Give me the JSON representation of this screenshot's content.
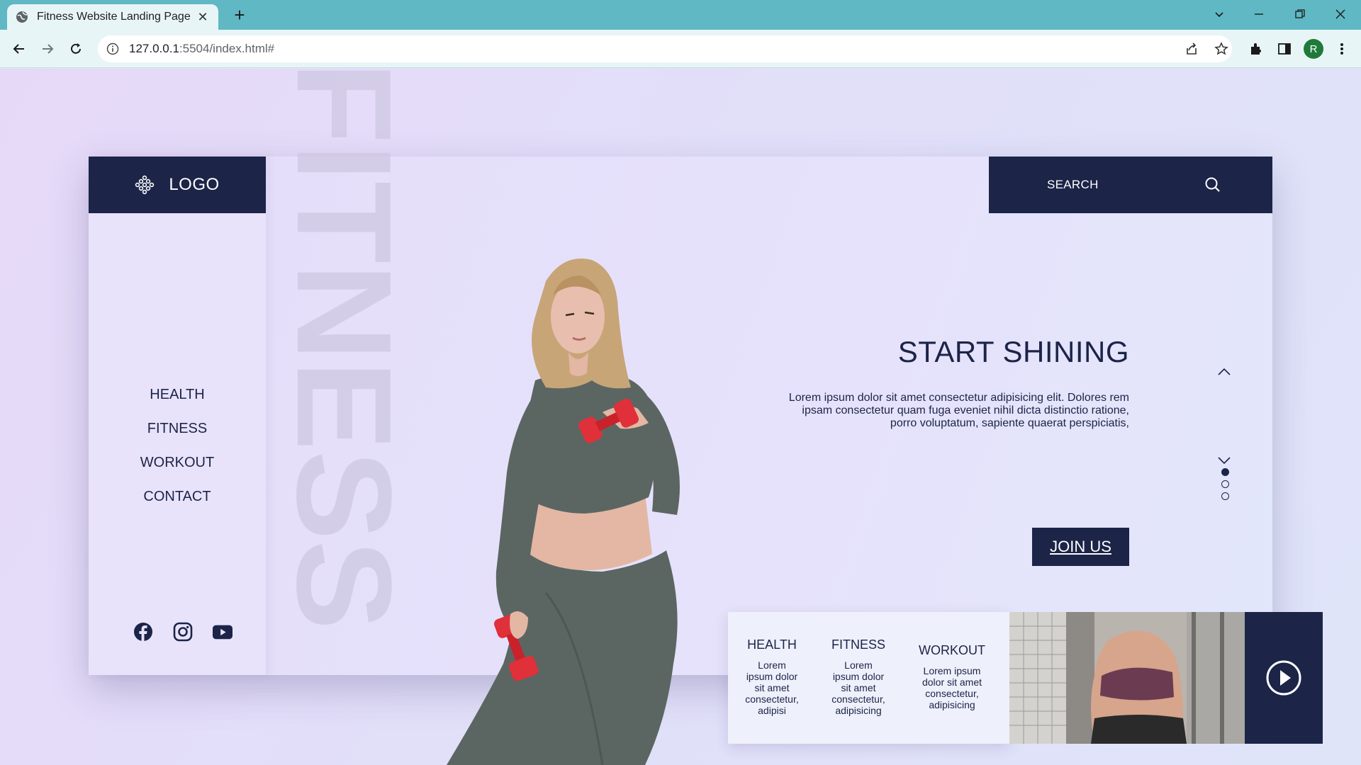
{
  "browser": {
    "tab_title": "Fitness Website Landing Page",
    "url_host": "127.0.0.1",
    "url_path": ":5504/index.html#",
    "profile_initial": "R"
  },
  "page": {
    "background_word": "FITNESS",
    "logo": {
      "text": "LOGO"
    },
    "nav": [
      {
        "label": "HEALTH"
      },
      {
        "label": "FITNESS"
      },
      {
        "label": "WORKOUT"
      },
      {
        "label": "CONTACT"
      }
    ],
    "socials": [
      "facebook-icon",
      "instagram-icon",
      "youtube-icon"
    ],
    "search": {
      "label": "SEARCH"
    },
    "hero": {
      "title": "START SHINING",
      "text_line1": "Lorem ipsum dolor sit amet consectetur adipisicing elit. Dolores rem",
      "text_line2": "ipsam consectetur quam fuga eveniet nihil dicta distinctio ratione,",
      "text_line3": "porro voluptatum, sapiente quaerat perspiciatis,",
      "cta": "JOIN US"
    },
    "slider": {
      "total": 3,
      "active": 1
    },
    "features": [
      {
        "title": "HEALTH",
        "l1": "Lorem",
        "l2": "ipsum dolor",
        "l3": "sit amet",
        "l4": "consectetur,",
        "l5": "adipisi"
      },
      {
        "title": "FITNESS",
        "l1": "Lorem",
        "l2": "ipsum dolor",
        "l3": "sit amet",
        "l4": "consectetur,",
        "l5": "adipisicing"
      },
      {
        "title": "WORKOUT",
        "l1": "Lorem ipsum",
        "l2": "dolor sit amet",
        "l3": "consectetur,",
        "l4": "adipisicing"
      }
    ],
    "colors": {
      "navy": "#1c2448",
      "accent_red": "#e0303a",
      "outfit": "#5b6663"
    }
  }
}
